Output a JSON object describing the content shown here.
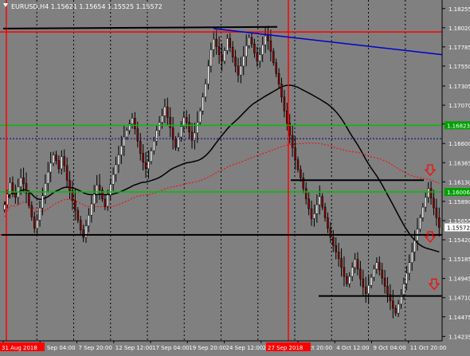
{
  "window": {
    "header": "EURUSD,H4  1.15621 1.15654 1.15525 1.15572"
  },
  "colors": {
    "background": "#808080",
    "bull_candle": "#ffffff",
    "bear_candle": "#8b0000",
    "wick": "#000000",
    "red_line": "#ff0000",
    "green_line": "#00c000",
    "blue_line": "#0000cc",
    "black_line": "#000000",
    "grid": "#000000",
    "axis_text": "#ffffff"
  },
  "chart_data": {
    "type": "candlestick",
    "symbol": "EURUSD",
    "timeframe": "H4",
    "ohlc_current": {
      "open": 1.15621,
      "high": 1.15654,
      "low": 1.15525,
      "close": 1.15572
    },
    "ylim": [
      1.1418,
      1.1836
    ],
    "y_ticks": [
      "1.18255",
      "1.18020",
      "1.17785",
      "1.17550",
      "1.17305",
      "1.17070",
      "1.16840",
      "1.16600",
      "1.16365",
      "1.16130",
      "1.15890",
      "1.15655",
      "1.15420",
      "1.15185",
      "1.14945",
      "1.14710",
      "1.14475",
      "1.14235"
    ],
    "x_ticks": [
      "31 Aug 2018",
      "5 Sep 04:00",
      "7 Sep 20:00",
      "12 Sep 12:00",
      "17 Sep 04:00",
      "19 Sep 20:00",
      "24 Sep 12:00",
      "27 Sep 04:00",
      "2 Oct 20:00",
      "4 Oct 12:00",
      "9 Oct 04:00",
      "11 Oct 20:00"
    ],
    "x_axis_markers": [
      {
        "label": "31 Aug 2018",
        "color": "#ff0000"
      },
      {
        "label": "27 Sep 2018",
        "color": "#ff0000"
      }
    ],
    "price_labels": [
      {
        "value": 1.16823,
        "text": "1.16823",
        "color": "#00a000"
      },
      {
        "value": 1.16006,
        "text": "1.16006",
        "color": "#00a000"
      },
      {
        "value": 1.15572,
        "text": "1.15572",
        "color": "#ffffff"
      }
    ],
    "horizontal_lines": [
      {
        "value": 1.17968,
        "color": "#ff0000",
        "style": "solid"
      },
      {
        "value": 1.16823,
        "color": "#00c000",
        "style": "solid"
      },
      {
        "value": 1.16006,
        "color": "#00c000",
        "style": "solid"
      },
      {
        "value": 1.1548,
        "color": "#ff0000",
        "style": "solid"
      },
      {
        "value": 1.1666,
        "color": "#000080",
        "style": "dotted"
      }
    ],
    "closes": [
      1.1585,
      1.1598,
      1.1612,
      1.1601,
      1.1594,
      1.1607,
      1.1618,
      1.1611,
      1.1599,
      1.1584,
      1.157,
      1.1556,
      1.1566,
      1.1581,
      1.1596,
      1.1611,
      1.1625,
      1.1636,
      1.1646,
      1.1639,
      1.1629,
      1.1644,
      1.1633,
      1.1615,
      1.1602,
      1.159,
      1.1578,
      1.1566,
      1.1554,
      1.1545,
      1.1559,
      1.1572,
      1.1586,
      1.1598,
      1.1609,
      1.1603,
      1.1592,
      1.1583,
      1.1597,
      1.161,
      1.1622,
      1.1634,
      1.1646,
      1.1657,
      1.1668,
      1.1676,
      1.1684,
      1.1691,
      1.1678,
      1.1663,
      1.1648,
      1.1637,
      1.1629,
      1.1638,
      1.1651,
      1.1663,
      1.1676,
      1.1686,
      1.1694,
      1.1705,
      1.1692,
      1.1679,
      1.1665,
      1.1655,
      1.1668,
      1.1681,
      1.1692,
      1.1686,
      1.1674,
      1.1664,
      1.1673,
      1.1686,
      1.17,
      1.1717,
      1.1733,
      1.1755,
      1.1775,
      1.1788,
      1.1779,
      1.1769,
      1.1761,
      1.1774,
      1.1789,
      1.1778,
      1.1766,
      1.1755,
      1.1744,
      1.1755,
      1.1767,
      1.178,
      1.179,
      1.1782,
      1.1771,
      1.1761,
      1.1769,
      1.1781,
      1.1792,
      1.1786,
      1.1773,
      1.1759,
      1.1746,
      1.1733,
      1.1717,
      1.17,
      1.1685,
      1.167,
      1.1655,
      1.164,
      1.1628,
      1.1618,
      1.1605,
      1.1592,
      1.158,
      1.1568,
      1.1574,
      1.1585,
      1.1595,
      1.1582,
      1.1569,
      1.1556,
      1.1545,
      1.1535,
      1.1527,
      1.1519,
      1.1508,
      1.1497,
      1.1488,
      1.1497,
      1.1508,
      1.1518,
      1.1506,
      1.1494,
      1.1484,
      1.1476,
      1.1486,
      1.1496,
      1.1506,
      1.1514,
      1.1505,
      1.1495,
      1.1485,
      1.1475,
      1.1467,
      1.1458,
      1.1452,
      1.1463,
      1.1475,
      1.1488,
      1.1501,
      1.1514,
      1.1527,
      1.1541,
      1.1555,
      1.1569,
      1.1582,
      1.1594,
      1.1605,
      1.1593,
      1.1581,
      1.1569,
      1.1557
    ]
  }
}
